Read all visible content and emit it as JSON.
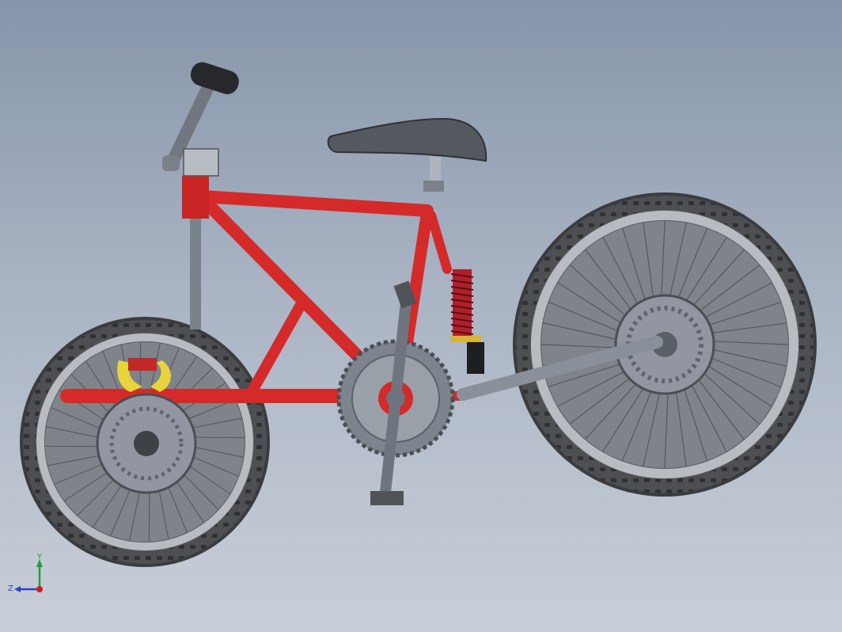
{
  "viewport": {
    "background_top": "#8795aa",
    "background_bottom": "#c9cfd8"
  },
  "model": {
    "frame_color": "#d42a2a",
    "tube_gray": "#6e7580",
    "tire_color": "#4d4f53",
    "rim_color": "#a8adb3",
    "disc_color": "#8a8f97",
    "spring_color": "#c41e2e",
    "caliper_color": "#e8d43a"
  },
  "triad": {
    "y_label": "Y",
    "z_label": "Z",
    "x_color": "#d21d1d",
    "y_color": "#1fa03b",
    "z_color": "#2b43c9"
  }
}
